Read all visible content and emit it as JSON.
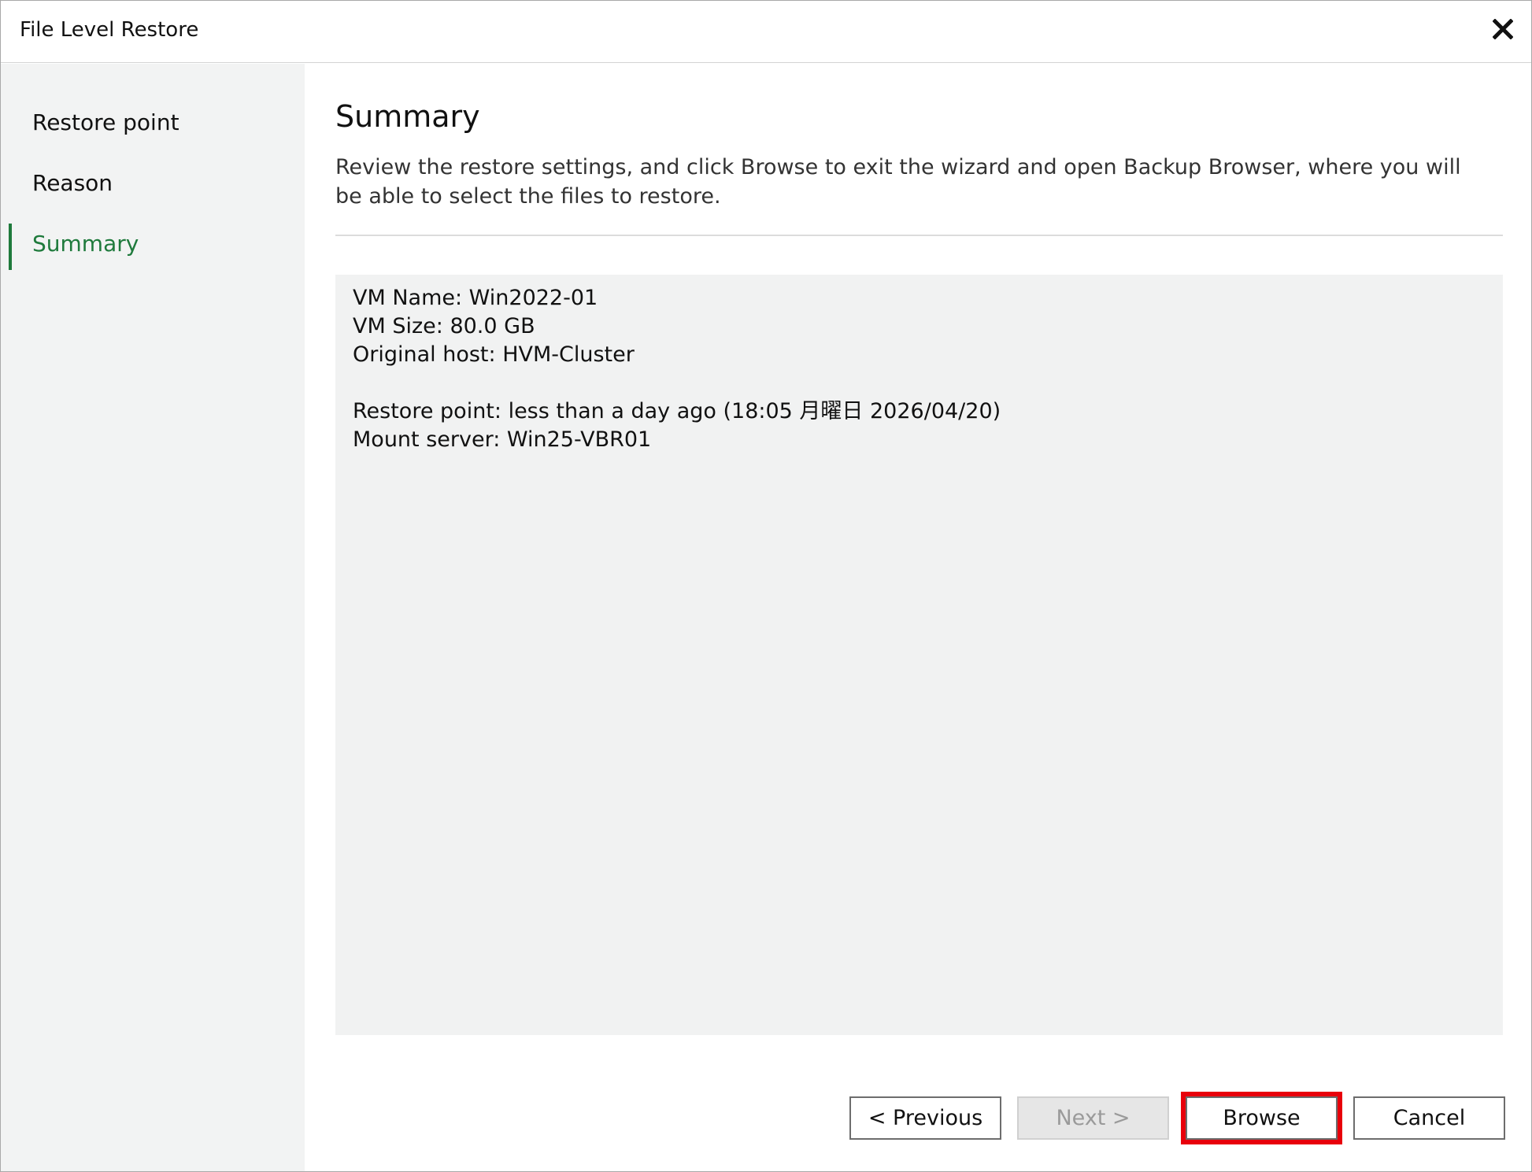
{
  "window": {
    "title": "File Level Restore"
  },
  "sidebar": {
    "items": [
      {
        "label": "Restore point"
      },
      {
        "label": "Reason"
      },
      {
        "label": "Summary",
        "active": true
      }
    ]
  },
  "main": {
    "heading": "Summary",
    "description": "Review the restore settings, and click Browse to exit the wizard and open Backup Browser, where you will be able to select the files to restore.",
    "summary_lines": [
      "VM Name: Win2022-01",
      "VM Size: 80.0 GB",
      "Original host: HVM-Cluster",
      "",
      "Restore point: less than a day ago (18:05 月曜日 2026/04/20)",
      "Mount server: Win25-VBR01"
    ]
  },
  "buttons": {
    "previous": "< Previous",
    "next": "Next >",
    "browse": "Browse",
    "cancel": "Cancel"
  },
  "colors": {
    "accent": "#1f7a3c",
    "highlight": "#e8000b"
  },
  "icons": {
    "close": "close-icon"
  }
}
